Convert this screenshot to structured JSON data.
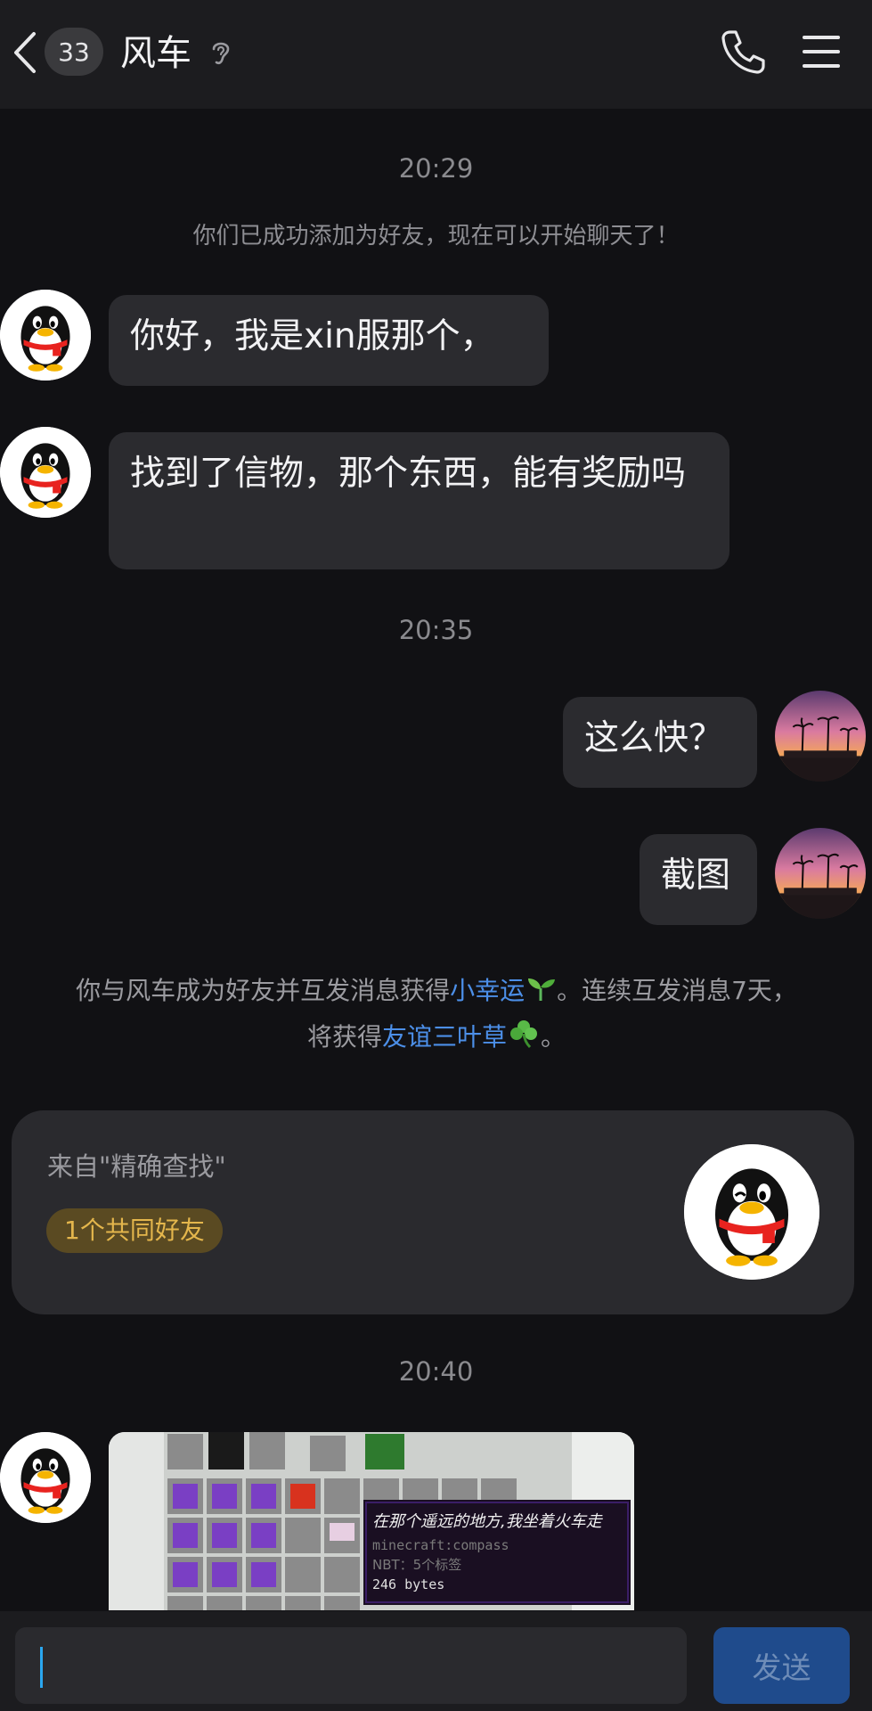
{
  "header": {
    "unread_count": "33",
    "title": "风车"
  },
  "messages": {
    "time_1": "20:29",
    "system_added": "你们已成功添加为好友，现在可以开始聊天了！",
    "msg_1": "你好，我是xin服那个，",
    "msg_2": "找到了信物，那个东西，能有奖励吗",
    "time_2": "20:35",
    "msg_3": "这么快？",
    "msg_4": "截图",
    "reward_line1_a": "你与风车成为好友并互发消息获得",
    "reward_line1_link": "小幸运",
    "reward_line1_b": "。连续互发消息7天，",
    "reward_line2_a": "将获得",
    "reward_line2_link": "友谊三叶草",
    "reward_line2_b": "。",
    "time_3": "20:40"
  },
  "source_card": {
    "label": "来自\"精确查找\"",
    "mutual_friends": "1个共同好友"
  },
  "image_message": {
    "tooltip_title": "在那个遥远的地方,我坐着火车走",
    "tooltip_id": "minecraft:compass",
    "tooltip_nbt": "NBT：5个标签",
    "tooltip_size": "246 bytes"
  },
  "input_bar": {
    "placeholder": "",
    "send_label": "发送"
  },
  "colors": {
    "background": "#111114",
    "header": "#1c1c1f",
    "bubble": "#2b2b2f",
    "link": "#4c8fe8",
    "badge_text": "#e4b64c",
    "send_button": "#1f4b8c"
  },
  "icons": [
    "chevron-left-icon",
    "ear-icon",
    "phone-icon",
    "menu-icon",
    "seedling-icon",
    "clover-icon"
  ]
}
